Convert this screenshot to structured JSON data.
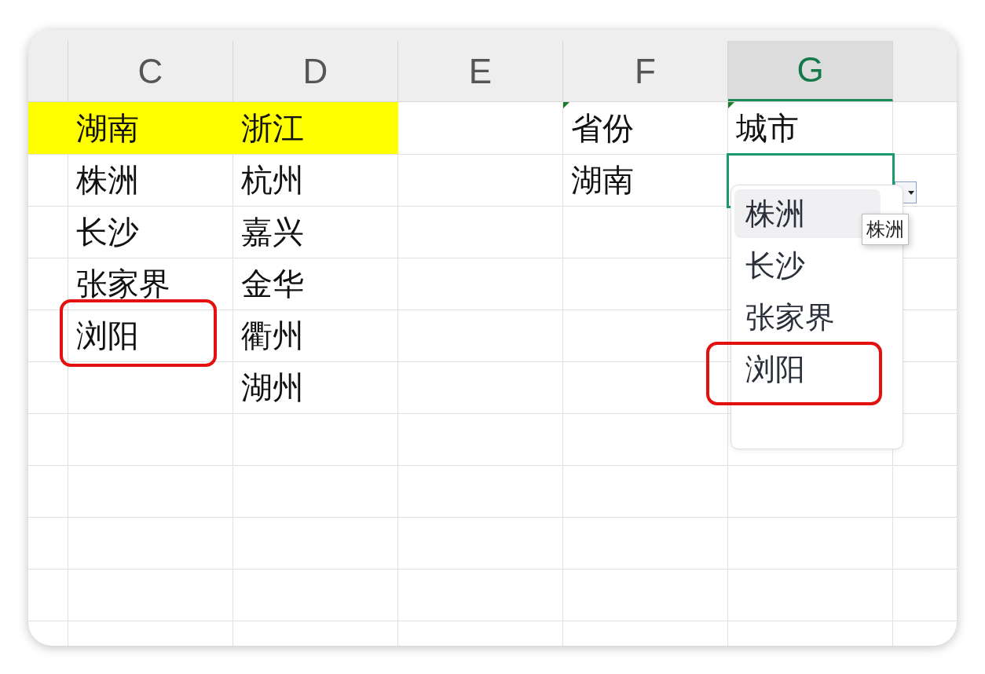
{
  "columns": [
    {
      "label": "C",
      "selected": false
    },
    {
      "label": "D",
      "selected": false
    },
    {
      "label": "E",
      "selected": false
    },
    {
      "label": "F",
      "selected": false
    },
    {
      "label": "G",
      "selected": true
    }
  ],
  "rows": [
    {
      "highlighted": true,
      "cells": [
        {
          "text": "湖南",
          "marked": false,
          "selected": false,
          "circled": false
        },
        {
          "text": "浙江",
          "marked": false,
          "selected": false,
          "circled": false
        },
        {
          "marked": false,
          "selected": false,
          "circled": false
        },
        {
          "text": "省份",
          "marked": true,
          "selected": false,
          "circled": false
        },
        {
          "text": "城市",
          "marked": true,
          "selected": false,
          "circled": false
        }
      ]
    },
    {
      "highlighted": false,
      "cells": [
        {
          "text": "株洲",
          "marked": false,
          "selected": false,
          "circled": false
        },
        {
          "text": "杭州",
          "marked": false,
          "selected": false,
          "circled": false
        },
        {
          "marked": false,
          "selected": false,
          "circled": false
        },
        {
          "text": "湖南",
          "marked": false,
          "selected": false,
          "circled": false
        },
        {
          "marked": false,
          "selected": true,
          "circled": false
        }
      ]
    },
    {
      "highlighted": false,
      "cells": [
        {
          "text": "长沙",
          "marked": false,
          "selected": false,
          "circled": false
        },
        {
          "text": "嘉兴",
          "marked": false,
          "selected": false,
          "circled": false
        },
        {
          "marked": false,
          "selected": false,
          "circled": false
        },
        {
          "marked": false,
          "selected": false,
          "circled": false
        },
        {
          "marked": false,
          "selected": false,
          "circled": false
        }
      ]
    },
    {
      "highlighted": false,
      "cells": [
        {
          "text": "张家界",
          "marked": false,
          "selected": false,
          "circled": false
        },
        {
          "text": "金华",
          "marked": false,
          "selected": false,
          "circled": false
        },
        {
          "marked": false,
          "selected": false,
          "circled": false
        },
        {
          "marked": false,
          "selected": false,
          "circled": false
        },
        {
          "marked": false,
          "selected": false,
          "circled": false
        }
      ]
    },
    {
      "highlighted": false,
      "cells": [
        {
          "text": "浏阳",
          "marked": false,
          "selected": false,
          "circled": true
        },
        {
          "text": "衢州",
          "marked": false,
          "selected": false,
          "circled": false
        },
        {
          "marked": false,
          "selected": false,
          "circled": false
        },
        {
          "marked": false,
          "selected": false,
          "circled": false
        },
        {
          "marked": false,
          "selected": false,
          "circled": false
        }
      ]
    },
    {
      "highlighted": false,
      "cells": [
        {
          "marked": false,
          "selected": false,
          "circled": false
        },
        {
          "text": "湖州",
          "marked": false,
          "selected": false,
          "circled": false
        },
        {
          "marked": false,
          "selected": false,
          "circled": false
        },
        {
          "marked": false,
          "selected": false,
          "circled": false
        },
        {
          "marked": false,
          "selected": false,
          "circled": false
        }
      ]
    }
  ],
  "dropdown": {
    "items": [
      {
        "label": "株洲",
        "selected": true,
        "circled": false
      },
      {
        "label": "长沙",
        "selected": false,
        "circled": false
      },
      {
        "label": "张家界",
        "selected": false,
        "circled": false
      },
      {
        "label": "浏阳",
        "selected": false,
        "circled": true
      }
    ],
    "tooltip": "株洲"
  }
}
